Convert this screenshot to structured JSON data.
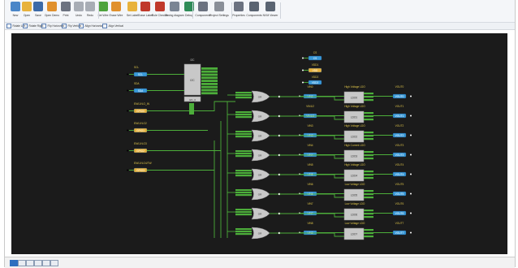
{
  "toolbar": {
    "items": [
      {
        "label": "New",
        "icon": "new-file-icon",
        "color": "#4a86c8"
      },
      {
        "label": "Open",
        "icon": "open-folder-icon",
        "color": "#e8b23c"
      },
      {
        "label": "Save",
        "icon": "save-icon",
        "color": "#3b6aa8"
      },
      {
        "label": "Open Demo",
        "icon": "demo-icon",
        "color": "#e0902c"
      },
      {
        "label": "Print",
        "icon": "print-icon",
        "color": "#6b7280"
      },
      {
        "label": "Undo",
        "icon": "undo-icon",
        "color": "#a8adb5"
      },
      {
        "label": "Redo",
        "icon": "redo-icon",
        "color": "#a8adb5"
      },
      {
        "label": "Set Wire",
        "icon": "wire-icon",
        "color": "#4ea33c"
      },
      {
        "label": "Erase Wire",
        "icon": "erase-wire-icon",
        "color": "#e0902c"
      },
      {
        "label": "Set Label",
        "icon": "label-icon",
        "color": "#e8b23c"
      },
      {
        "label": "Erase Label",
        "icon": "erase-label-icon",
        "color": "#c0392b"
      },
      {
        "label": "Rule Checker",
        "icon": "rule-checker-icon",
        "color": "#c0392b"
      },
      {
        "label": "Timing diagram",
        "icon": "timing-diagram-icon",
        "color": "#7a8594"
      },
      {
        "label": "Debug",
        "icon": "debug-icon",
        "color": "#2e8b57"
      },
      {
        "label": "Components",
        "icon": "components-icon",
        "color": "#6b7280"
      },
      {
        "label": "Project Settings",
        "icon": "settings-icon",
        "color": "#8a8f98"
      },
      {
        "label": "Properties",
        "icon": "properties-icon",
        "color": "#6b7280"
      },
      {
        "label": "Components",
        "icon": "components-list-icon",
        "color": "#5a6472"
      },
      {
        "label": "NVM Viewer",
        "icon": "nvm-viewer-icon",
        "color": "#5a6472"
      }
    ]
  },
  "subbar": {
    "items": [
      {
        "label": "Rotate Left"
      },
      {
        "label": "Rotate Right"
      },
      {
        "label": "Flip Horizontal"
      },
      {
        "label": "Flip Vertical"
      },
      {
        "label": "Align Horizontal"
      },
      {
        "label": "Align Vertical"
      }
    ]
  },
  "schematic": {
    "colors": {
      "canvas": "#1b1b1b",
      "wire": "#4cae3a",
      "pin_blue": "#3a9ad9",
      "pin_yellow": "#e8b23c",
      "title": "#e0c64a",
      "block": "#c8c8c8"
    },
    "inputs": [
      {
        "title": "SCL",
        "pin": "SCL"
      },
      {
        "title": "SDA",
        "pin": "SDA"
      },
      {
        "title": "EN/UVLO_IN",
        "pin": "GPIO0"
      },
      {
        "title": "EN/UVLO2",
        "pin": "GPIO1"
      },
      {
        "title": "EN/UVLO3",
        "pin": "GPIO2"
      },
      {
        "title": "EN/UVLO4/TW",
        "pin": "GPIO3"
      }
    ],
    "i2c_block": {
      "title": "I2C",
      "label": "I2C",
      "sub": "I2C_0"
    },
    "top_pins": [
      {
        "title": "CS",
        "pin": "CS"
      },
      {
        "title": "VDD1",
        "pin": "VDD"
      },
      {
        "title": "VDD2",
        "pin": "VDD2"
      }
    ],
    "ldos": [
      {
        "vin_title": "VIN0",
        "vin": "VIN0",
        "title": "High Voltage LDO",
        "block": "LDO0",
        "out_title": "VOUT0",
        "out": "VOUT0"
      },
      {
        "vin_title": "VIN1/2",
        "vin": "VIN1/2",
        "title": "High Voltage LDO",
        "block": "LDO1",
        "out_title": "VOUT1",
        "out": "VOUT1"
      },
      {
        "vin_title": "VIN3",
        "vin": "VIN3",
        "title": "High Voltage LDO",
        "block": "LDO2",
        "out_title": "VOUT2",
        "out": "VOUT2"
      },
      {
        "vin_title": "VIN4",
        "vin": "VIN4",
        "title": "High Current LDO",
        "block": "LDO3",
        "out_title": "VOUT3",
        "out": "VOUT3"
      },
      {
        "vin_title": "VIN5",
        "vin": "VIN5",
        "title": "High Voltage LDO",
        "block": "LDO4",
        "out_title": "VOUT4",
        "out": "VOUT4"
      },
      {
        "vin_title": "VIN6",
        "vin": "VIN6",
        "title": "Low Voltage LDO",
        "block": "LDO5",
        "out_title": "VOUT5",
        "out": "VOUT5"
      },
      {
        "vin_title": "VIN7",
        "vin": "VIN7",
        "title": "Low Voltage LDO",
        "block": "LDO6",
        "out_title": "VOUT6",
        "out": "VOUT6"
      },
      {
        "vin_title": "VIN8",
        "vin": "VIN8",
        "title": "Low Voltage LDO",
        "block": "LDO7",
        "out_title": "VOUT7",
        "out": "VOUT7"
      }
    ],
    "gate_label": "OR"
  }
}
